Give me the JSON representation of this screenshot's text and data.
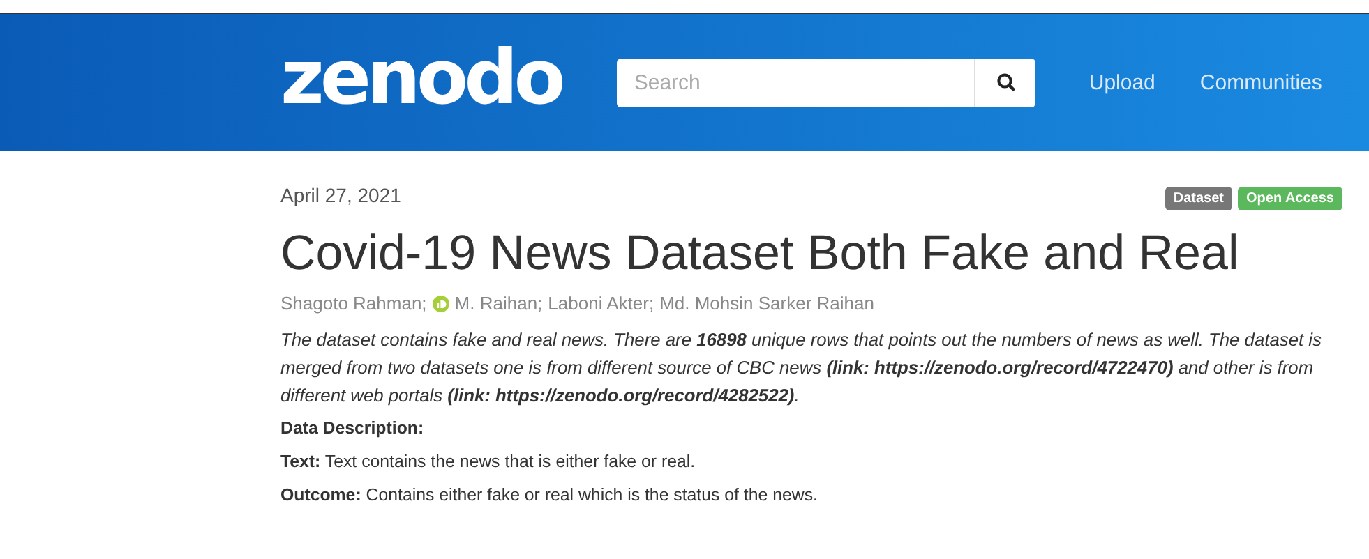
{
  "header": {
    "logo": "zenodo",
    "search": {
      "placeholder": "Search"
    },
    "nav": [
      "Upload",
      "Communities"
    ]
  },
  "record": {
    "date": "April 27, 2021",
    "badges": [
      {
        "label": "Dataset",
        "color": "#777777"
      },
      {
        "label": "Open Access",
        "color": "#5cb85c"
      }
    ],
    "title": "Covid-19 News Dataset Both Fake and Real",
    "authors": [
      {
        "name": "Shagoto Rahman;",
        "orcid": false
      },
      {
        "name": "M. Raihan;",
        "orcid": true
      },
      {
        "name": "Laboni Akter;",
        "orcid": false
      },
      {
        "name": "Md. Mohsin Sarker Raihan",
        "orcid": false
      }
    ],
    "description": "The dataset contains fake and real news. There are **16898** unique rows that points out the numbers of news as well. The dataset is merged from two datasets one is from different source of CBC news **(link: https://zenodo.org/record/4722470)** and other is from different web portals **(link: https://zenodo.org/record/4282522)**.",
    "section_heading": "Data Description:",
    "definitions": [
      "**Text:** Text contains the news that is either fake or real.",
      "**Outcome:** Contains either fake or real which is the status of the news."
    ]
  }
}
